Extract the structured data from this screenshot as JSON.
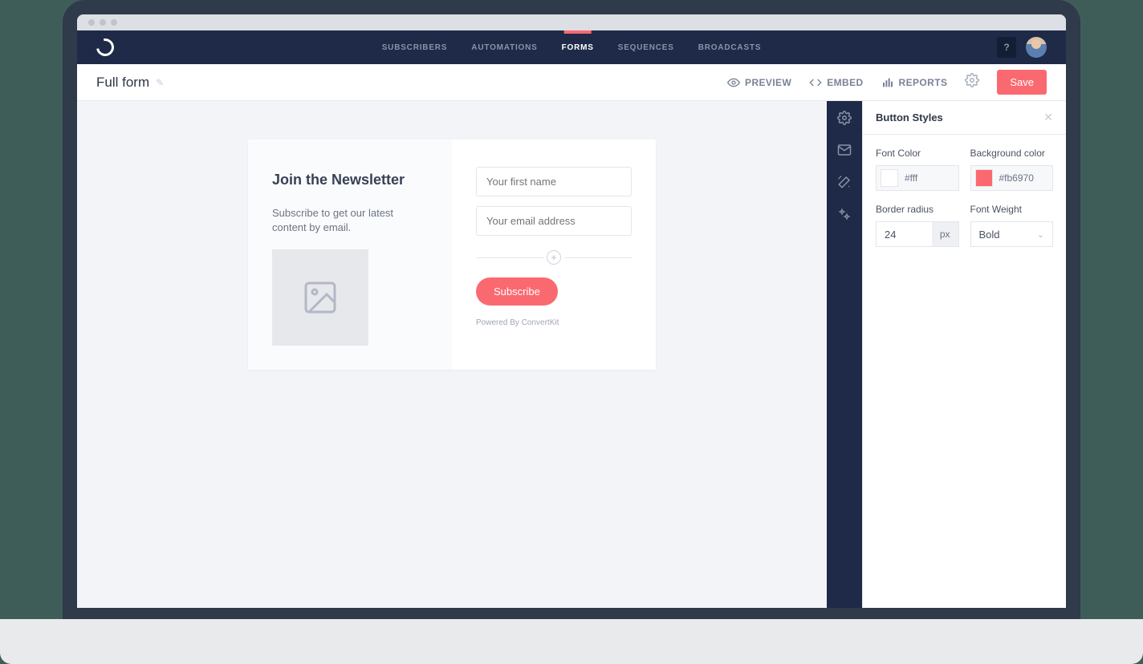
{
  "nav": {
    "items": [
      "SUBSCRIBERS",
      "AUTOMATIONS",
      "FORMS",
      "SEQUENCES",
      "BROADCASTS"
    ],
    "active": "FORMS",
    "help": "?"
  },
  "subheader": {
    "title": "Full form",
    "preview": "PREVIEW",
    "embed": "EMBED",
    "reports": "REPORTS",
    "save": "Save"
  },
  "form": {
    "heading": "Join the Newsletter",
    "blurb": "Subscribe to get our latest content by email.",
    "first_name_placeholder": "Your first name",
    "email_placeholder": "Your email address",
    "subscribe": "Subscribe",
    "powered": "Powered By ConvertKit"
  },
  "panel": {
    "title": "Button Styles",
    "labels": {
      "font_color": "Font Color",
      "bg_color": "Background color",
      "border_radius": "Border radius",
      "font_weight": "Font Weight"
    },
    "font_color": "#fff",
    "bg_color": "#fb6970",
    "border_radius": "24",
    "border_radius_unit": "px",
    "font_weight": "Bold"
  }
}
